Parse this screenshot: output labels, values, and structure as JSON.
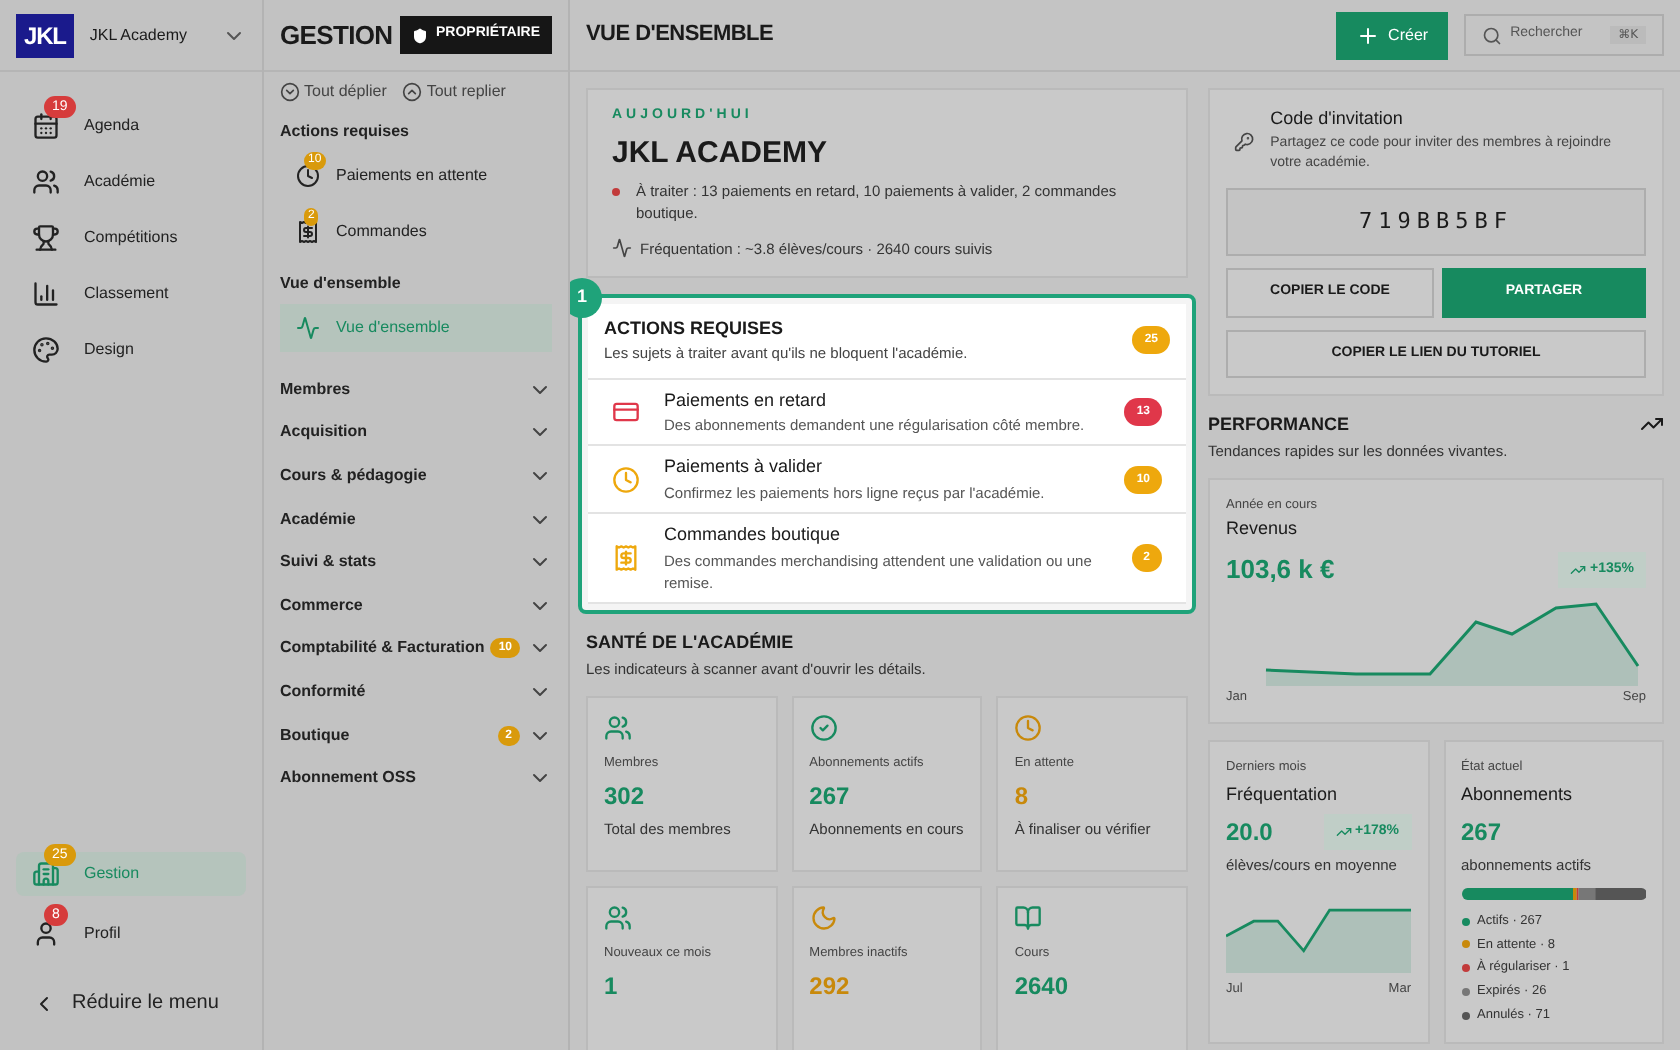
{
  "academy": {
    "logo": "JKL",
    "name": "JKL Academy"
  },
  "nav": [
    {
      "kind": "calendar",
      "label": "Agenda",
      "selected": false,
      "badge": {
        "text": "19",
        "color": "#d63c3c"
      }
    },
    {
      "kind": "people",
      "label": "Académie",
      "selected": false
    },
    {
      "kind": "trophy",
      "label": "Compétitions",
      "selected": false
    },
    {
      "kind": "chart",
      "label": "Classement",
      "selected": false
    },
    {
      "kind": "palette",
      "label": "Design",
      "selected": false
    }
  ],
  "bottom_nav": [
    {
      "kind": "building",
      "label": "Gestion",
      "selected": true,
      "badge": {
        "text": "25",
        "color": "#d99a0b"
      }
    },
    {
      "kind": "user",
      "label": "Profil",
      "selected": false,
      "badge": {
        "text": "8",
        "color": "#d63c3c"
      }
    }
  ],
  "collapse_label": "Réduire le menu",
  "section": {
    "title": "GESTION",
    "role": "PROPRIÉTAIRE",
    "expand_all": "Tout déplier",
    "collapse_all": "Tout replier",
    "groups": [
      {
        "label": "Actions requises",
        "children": [
          {
            "kind": "clock",
            "label": "Paiements en attente",
            "selected": false,
            "badge": "10"
          },
          {
            "kind": "receipt",
            "label": "Commandes",
            "selected": false,
            "badge": "2"
          }
        ]
      },
      {
        "label": "Vue d'ensemble",
        "children": [
          {
            "kind": "pulse",
            "label": "Vue d'ensemble",
            "selected": true
          }
        ]
      }
    ],
    "menus": [
      {
        "label": "Membres",
        "expanded": false
      },
      {
        "label": "Acquisition",
        "expanded": false
      },
      {
        "label": "Cours & pédagogie",
        "expanded": false
      },
      {
        "label": "Académie",
        "expanded": false
      },
      {
        "label": "Suivi & stats",
        "expanded": false
      },
      {
        "label": "Commerce",
        "expanded": false
      },
      {
        "label": "Comptabilité & Facturation",
        "expanded": false,
        "badge": "10"
      },
      {
        "label": "Conformité",
        "expanded": false
      },
      {
        "label": "Boutique",
        "expanded": false,
        "badge": "2"
      },
      {
        "label": "Abonnement OSS",
        "expanded": false
      }
    ]
  },
  "header": {
    "title": "VUE D'ENSEMBLE",
    "create": "Créer",
    "search_placeholder": "Rechercher",
    "shortcut": "⌘K"
  },
  "today": {
    "eyebrow": "AUJOURD'HUI",
    "title": "JKL ACADEMY",
    "alert": "À traiter : 13 paiements en retard, 10 paiements à valider, 2 commandes boutique.",
    "attendance": "Fréquentation : ~3.8 élèves/cours · 2640 cours suivis"
  },
  "actions": {
    "step": "1",
    "title": "ACTIONS REQUISES",
    "subtitle": "Les sujets à traiter avant qu'ils ne bloquent l'académie.",
    "count": "25",
    "items": [
      {
        "kind": "card",
        "title": "Paiements en retard",
        "text": "Des abonnements demandent une régularisation côté membre.",
        "count": "13",
        "color": "#e0374a"
      },
      {
        "kind": "clock",
        "title": "Paiements à valider",
        "text": "Confirmez les paiements hors ligne reçus par l'académie.",
        "count": "10",
        "color": "#eea80d"
      },
      {
        "kind": "receipt",
        "title": "Commandes boutique",
        "text": "Des commandes merchandising attendent une validation ou une remise.",
        "count": "2",
        "color": "#eea80d"
      }
    ]
  },
  "health": {
    "title": "SANTÉ DE L'ACADÉMIE",
    "subtitle": "Les indicateurs à scanner avant d'ouvrir les détails.",
    "stats": [
      {
        "kind": "people",
        "label": "Membres",
        "value": "302",
        "caption": "Total des membres",
        "color": "#178a5f"
      },
      {
        "kind": "check",
        "label": "Abonnements actifs",
        "value": "267",
        "caption": "Abonnements en cours",
        "color": "#178a5f"
      },
      {
        "kind": "clock",
        "label": "En attente",
        "value": "8",
        "caption": "À finaliser ou vérifier",
        "color": "#c8890b"
      },
      {
        "kind": "people",
        "label": "Nouveaux ce mois",
        "value": "1",
        "color": "#178a5f"
      },
      {
        "kind": "moon",
        "label": "Membres inactifs",
        "value": "292",
        "color": "#c8890b"
      },
      {
        "kind": "book",
        "label": "Cours",
        "value": "2640",
        "color": "#178a5f"
      }
    ]
  },
  "invite": {
    "title": "Code d'invitation",
    "text": "Partagez ce code pour inviter des membres à rejoindre votre académie.",
    "code": "719BB5BF",
    "copy": "COPIER LE CODE",
    "share": "PARTAGER",
    "tutorial": "COPIER LE LIEN DU TUTORIEL"
  },
  "performance": {
    "title": "PERFORMANCE",
    "subtitle": "Tendances rapides sur les données vivantes.",
    "revenue": {
      "eyebrow": "Année en cours",
      "title": "Revenus",
      "value": "103,6 k €",
      "trend": "+135%",
      "x_start": "Jan",
      "x_end": "Sep"
    },
    "attendance": {
      "eyebrow": "Derniers mois",
      "title": "Fréquentation",
      "value": "20.0",
      "trend": "+178%",
      "caption": "élèves/cours en moyenne",
      "x_start": "Jul",
      "x_end": "Mar"
    },
    "subscriptions": {
      "eyebrow": "État actuel",
      "title": "Abonnements",
      "value": "267",
      "caption": "abonnements actifs",
      "segments": [
        {
          "label": "Actifs · 267",
          "color": "#178a5f"
        },
        {
          "label": "En attente · 8",
          "color": "#c8890b"
        },
        {
          "label": "À régulariser · 1",
          "color": "#c23b3b"
        },
        {
          "label": "Expirés · 26",
          "color": "#777777"
        },
        {
          "label": "Annulés · 71",
          "color": "#555555"
        }
      ]
    }
  }
}
